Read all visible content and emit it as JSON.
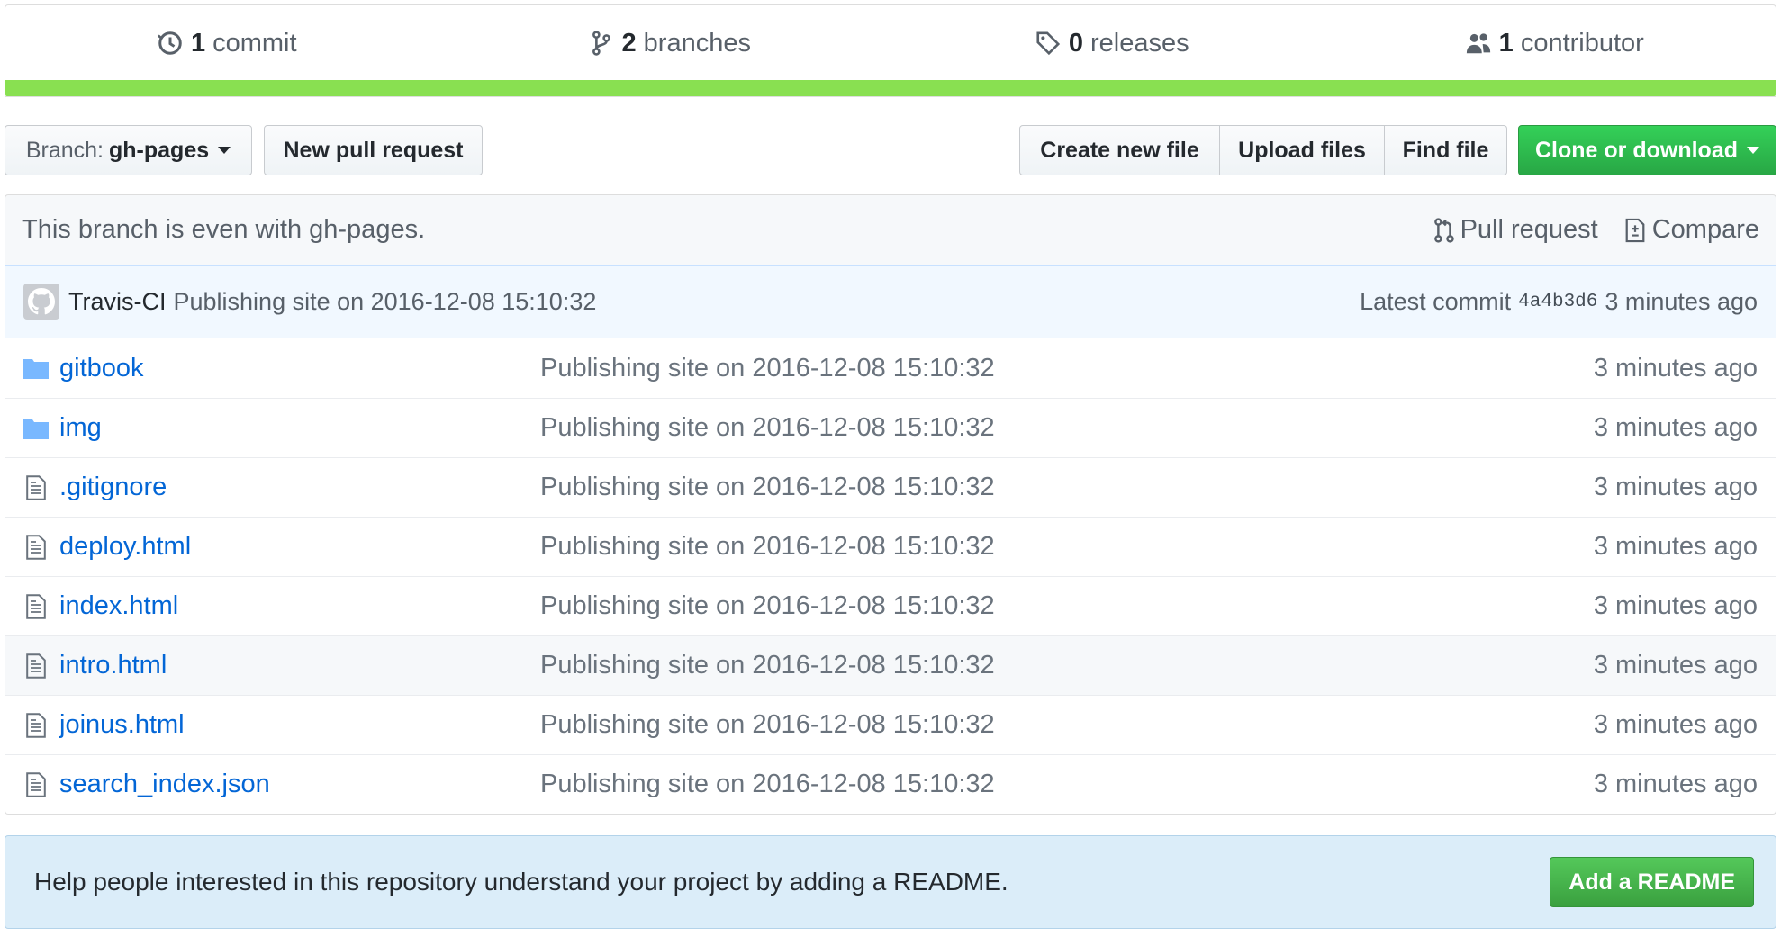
{
  "summary": {
    "commits": {
      "count": "1",
      "label": "commit"
    },
    "branches": {
      "count": "2",
      "label": "branches"
    },
    "releases": {
      "count": "0",
      "label": "releases"
    },
    "contributors": {
      "count": "1",
      "label": "contributor"
    },
    "language_color": "#89e051"
  },
  "toolbar": {
    "branch_prefix": "Branch:",
    "branch_name": "gh-pages",
    "new_pull_request": "New pull request",
    "create_new_file": "Create new file",
    "upload_files": "Upload files",
    "find_file": "Find file",
    "clone_or_download": "Clone or download"
  },
  "branch_info": {
    "status": "This branch is even with gh-pages.",
    "pull_request": "Pull request",
    "compare": "Compare"
  },
  "latest_commit": {
    "author": "Travis-CI",
    "message": "Publishing site on 2016-12-08 15:10:32",
    "label": "Latest commit",
    "sha": "4a4b3d6",
    "age": "3 minutes ago"
  },
  "files": [
    {
      "type": "folder",
      "icon": "folder-icon",
      "name": "gitbook",
      "message": "Publishing site on 2016-12-08 15:10:32",
      "age": "3 minutes ago"
    },
    {
      "type": "folder",
      "icon": "folder-icon",
      "name": "img",
      "message": "Publishing site on 2016-12-08 15:10:32",
      "age": "3 minutes ago"
    },
    {
      "type": "file",
      "icon": "file-icon",
      "name": ".gitignore",
      "message": "Publishing site on 2016-12-08 15:10:32",
      "age": "3 minutes ago"
    },
    {
      "type": "file",
      "icon": "file-icon",
      "name": "deploy.html",
      "message": "Publishing site on 2016-12-08 15:10:32",
      "age": "3 minutes ago"
    },
    {
      "type": "file",
      "icon": "file-icon",
      "name": "index.html",
      "message": "Publishing site on 2016-12-08 15:10:32",
      "age": "3 minutes ago"
    },
    {
      "type": "file",
      "icon": "file-icon",
      "name": "intro.html",
      "message": "Publishing site on 2016-12-08 15:10:32",
      "age": "3 minutes ago"
    },
    {
      "type": "file",
      "icon": "file-icon",
      "name": "joinus.html",
      "message": "Publishing site on 2016-12-08 15:10:32",
      "age": "3 minutes ago"
    },
    {
      "type": "file",
      "icon": "file-icon",
      "name": "search_index.json",
      "message": "Publishing site on 2016-12-08 15:10:32",
      "age": "3 minutes ago"
    }
  ],
  "readme_prompt": {
    "text": "Help people interested in this repository understand your project by adding a README.",
    "button": "Add a README"
  },
  "colors": {
    "link": "#0366d6",
    "green_button": "#28a745",
    "folder": "#79b8ff"
  }
}
